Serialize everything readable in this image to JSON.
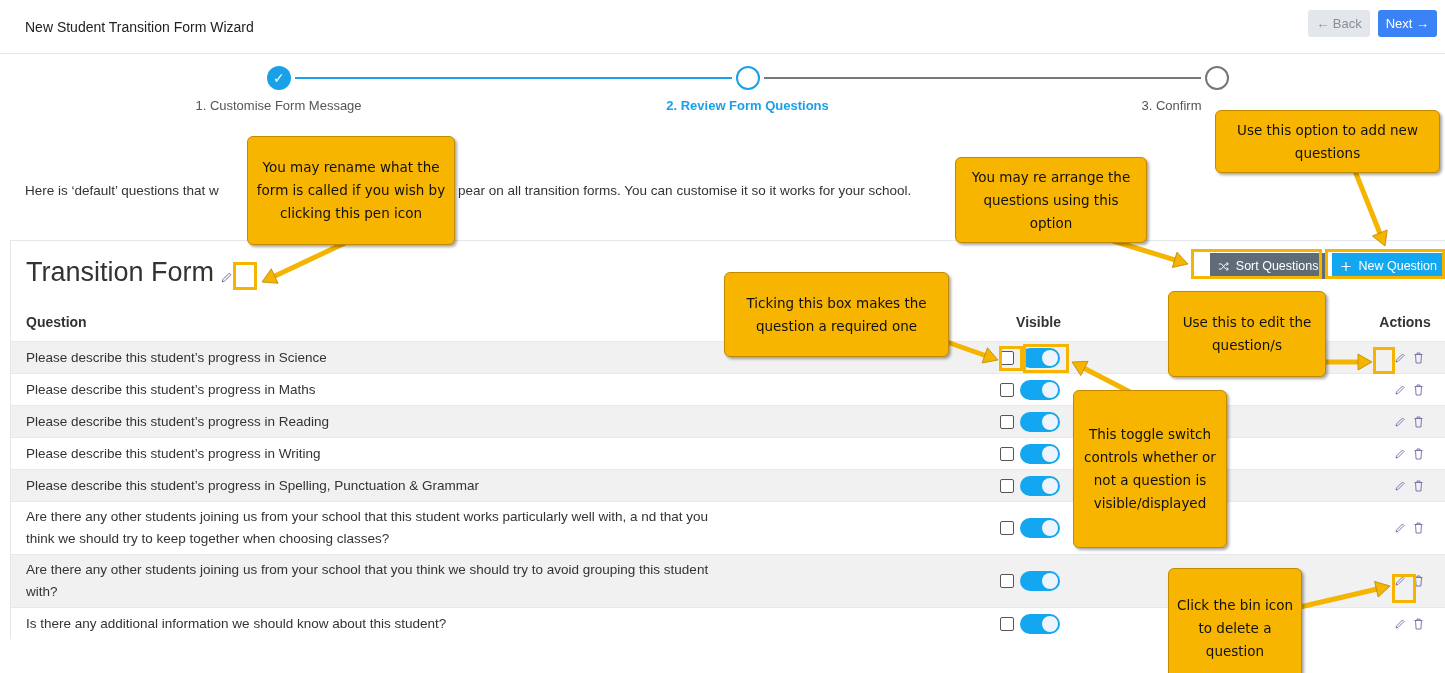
{
  "window": {
    "title": "New Student Transition Form Wizard"
  },
  "nav_buttons": [
    {
      "label": "← Back",
      "kind": "back",
      "disabled": true
    },
    {
      "label": "Next →",
      "kind": "next",
      "disabled": false
    }
  ],
  "steps": [
    {
      "label": "1. Customise Form Message",
      "completed": true,
      "selected": false,
      "icon": "✓"
    },
    {
      "label": "2. Review Form Questions",
      "completed": false,
      "selected": true
    },
    {
      "label": "3. Confirm",
      "completed": false,
      "selected": false
    }
  ],
  "intro": [
    "Here is ‘default’ questions that w",
    "pear on all transition forms. You can customise it so it works for your school."
  ],
  "form": {
    "title": "Transition Form",
    "buttons": [
      {
        "label": "Sort Questions",
        "kind": "sort"
      },
      {
        "label": "New Question",
        "kind": "new"
      }
    ]
  },
  "table": {
    "columns": [
      "Question",
      "Visible",
      "Actions"
    ],
    "rows": [
      {
        "question": "Please describe this student’s progress in Science",
        "required": false,
        "visible": true
      },
      {
        "question": "Please describe this student’s progress in Maths",
        "required": false,
        "visible": true
      },
      {
        "question": "Please describe this student’s progress in Reading",
        "required": false,
        "visible": true
      },
      {
        "question": "Please describe this student’s progress in Writing",
        "required": false,
        "visible": true
      },
      {
        "question": "Please describe this student’s progress in Spelling, Punctuation & Grammar",
        "required": false,
        "visible": true
      },
      {
        "question": "Are there any other students joining us from your school that this student works particularly well with, a nd that you think we should try to keep together when choosing classes?",
        "required": false,
        "visible": true
      },
      {
        "question": "Are there any other students joining us from your school that you think we should try to avoid grouping this student with?",
        "required": false,
        "visible": true
      },
      {
        "question": "Is there any additional information we should know about this student?",
        "required": false,
        "visible": true
      }
    ]
  },
  "callouts": [
    "You may rename what the form is called if you wish by clicking this pen icon",
    "You may re arrange the questions using this option",
    "Use this option to add new questions",
    "Ticking this box makes the question a required one",
    "Use this to edit the question/s",
    "This toggle switch controls whether or not a question is visible/displayed",
    "Click the bin icon to delete a question"
  ]
}
